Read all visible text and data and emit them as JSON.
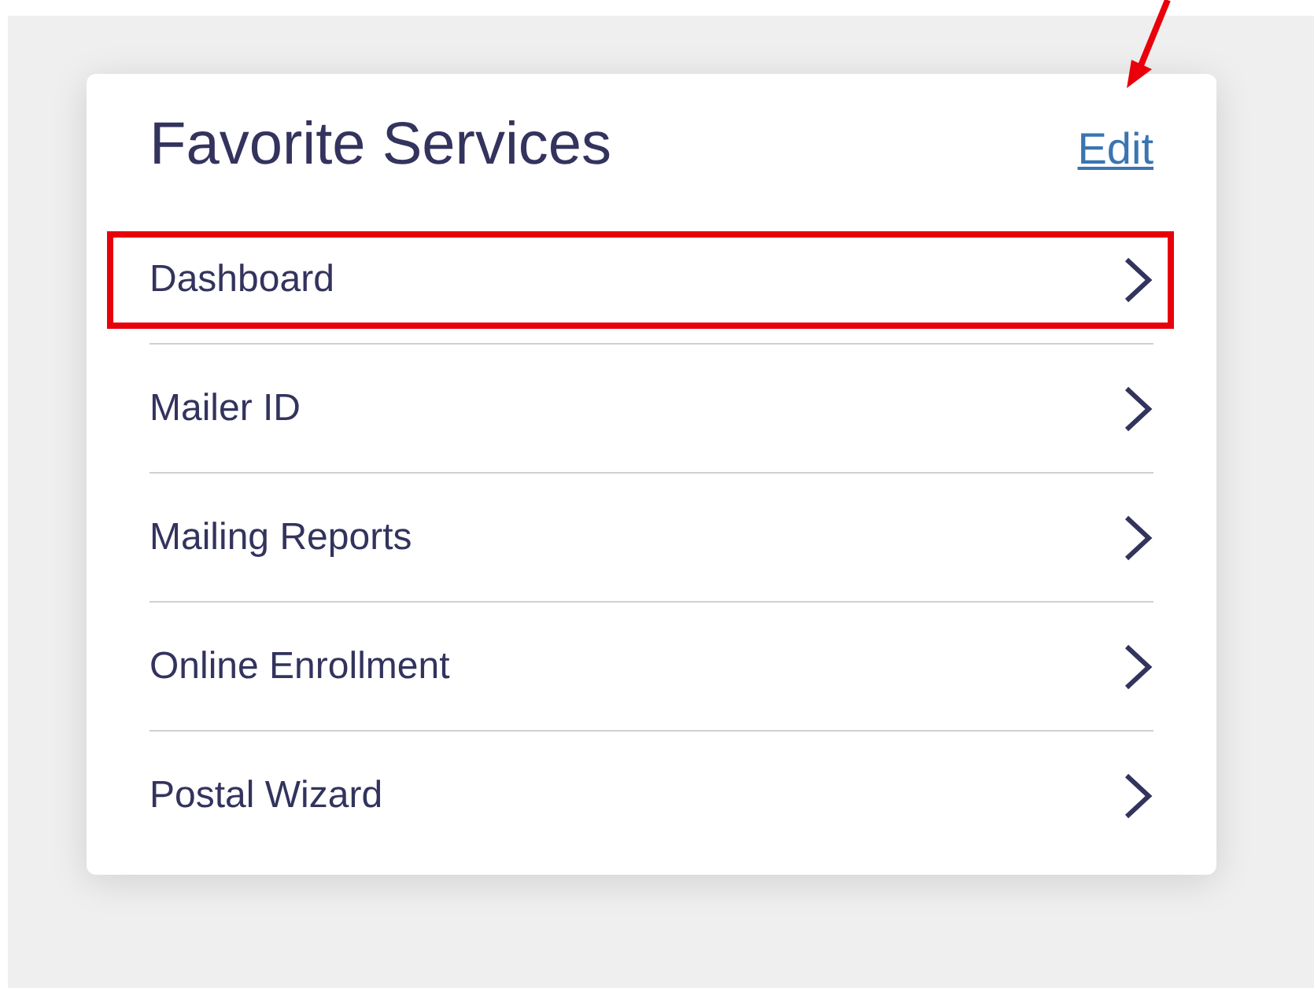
{
  "card": {
    "title": "Favorite Services",
    "edit": {
      "label": "Edit",
      "annotated": true
    }
  },
  "items": [
    {
      "label": "Dashboard",
      "highlighted": true
    },
    {
      "label": "Mailer ID",
      "highlighted": false
    },
    {
      "label": "Mailing Reports",
      "highlighted": false
    },
    {
      "label": "Online Enrollment",
      "highlighted": false
    },
    {
      "label": "Postal Wizard",
      "highlighted": false
    }
  ]
}
